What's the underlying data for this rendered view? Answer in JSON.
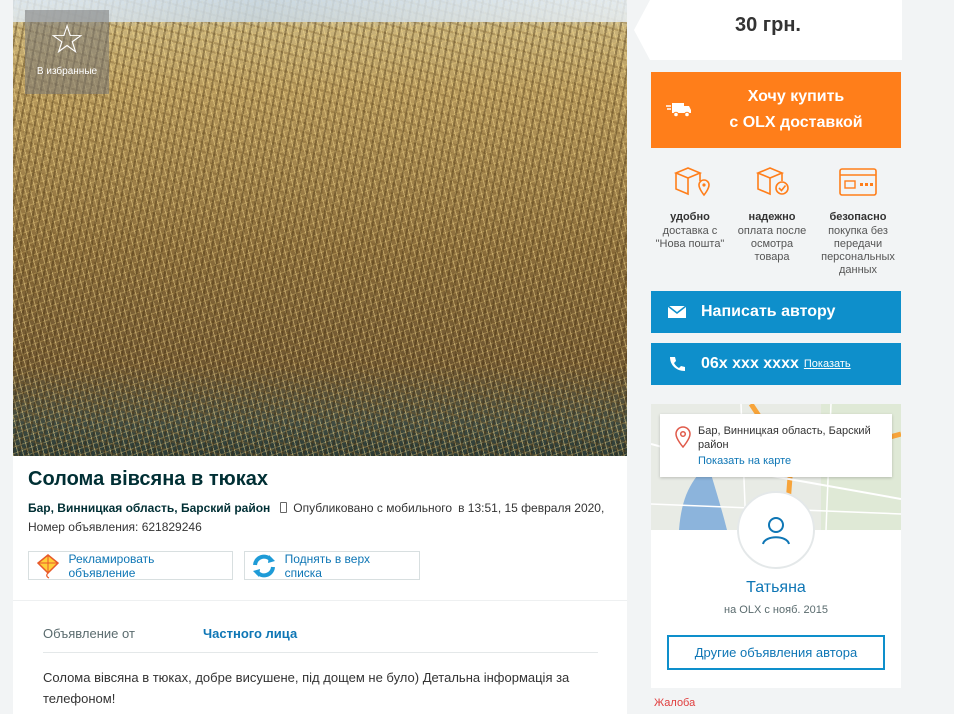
{
  "favorite": {
    "label": "В избранные",
    "icon": "star-icon"
  },
  "ad": {
    "title": "Солома вівсяна в тюках",
    "location": "Бар, Винницкая область, Барский район",
    "published": "Опубликовано с мобильного",
    "published_at": "в 13:51, 15 февраля 2020, Номер объявления: 621829246",
    "promote_label": "Рекламировать объявление",
    "bump_label": "Поднять в верх списка",
    "param_label": "Объявление от",
    "param_value": "Частного лица",
    "description": "Солома вівсяна в тюках, добре висушене, під дощем не було) Детальна інформація за телефоном!"
  },
  "price": "30 грн.",
  "buy_button": {
    "line1": "Хочу купить",
    "line2": "с OLX доставкой"
  },
  "features": [
    {
      "title": "удобно",
      "text": "доставка с \"Нова пошта\"",
      "icon": "box-location-icon"
    },
    {
      "title": "надежно",
      "text": "оплата после осмотра товара",
      "icon": "box-check-icon"
    },
    {
      "title": "безопасно",
      "text": "покупка без передачи персональных данных",
      "icon": "card-icon"
    }
  ],
  "write_button": "Написать автору",
  "phone": {
    "number": "06x xxx xxxx",
    "show_label": "Показать"
  },
  "map": {
    "location": "Бар, Винницкая область, Барский район",
    "show_on_map": "Показать на карте"
  },
  "user": {
    "name": "Татьяна",
    "since": "на OLX с нояб. 2015",
    "other_ads": "Другие объявления автора"
  },
  "complaint": "Жалоба",
  "colors": {
    "accent_orange": "#ff7e1a",
    "accent_blue": "#0e8fcb",
    "link_blue": "#0e76b5",
    "complaint_red": "#e03d3d"
  }
}
